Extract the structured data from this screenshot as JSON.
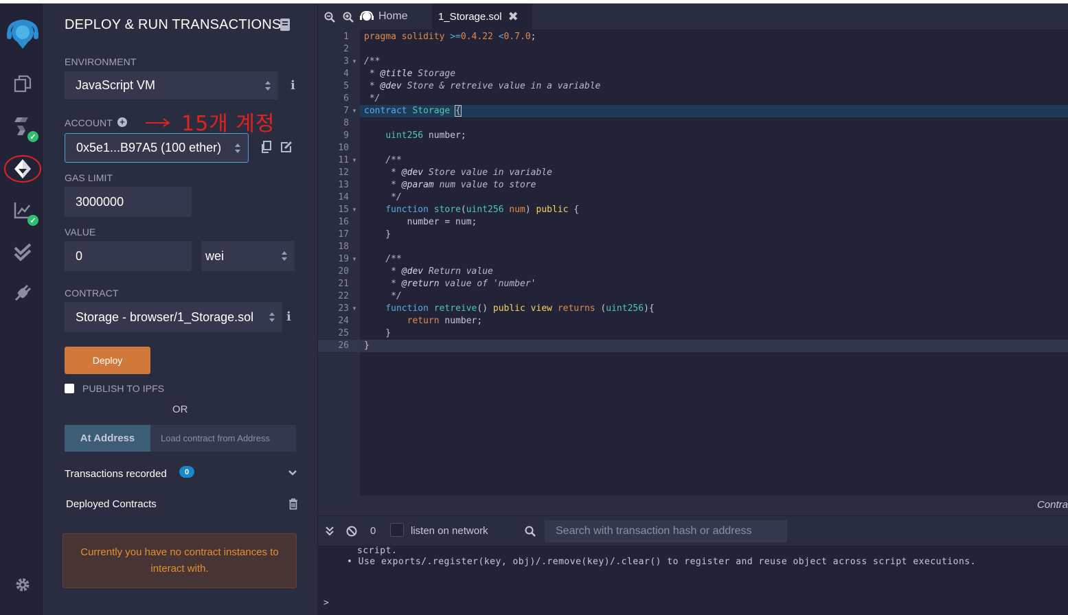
{
  "panel": {
    "title": "DEPLOY & RUN TRANSACTIONS",
    "environment_label": "ENVIRONMENT",
    "environment_value": "JavaScript VM",
    "account_label": "ACCOUNT",
    "account_value": "0x5e1...B97A5 (100 ether)",
    "annotation": "15개 계정",
    "gas_limit_label": "GAS LIMIT",
    "gas_limit_value": "3000000",
    "value_label": "VALUE",
    "value_amount": "0",
    "value_unit": "wei",
    "contract_label": "CONTRACT",
    "contract_value": "Storage - browser/1_Storage.sol",
    "deploy_label": "Deploy",
    "publish_label": "PUBLISH TO IPFS",
    "or_label": "OR",
    "at_address_label": "At Address",
    "load_placeholder": "Load contract from Address",
    "transactions_label": "Transactions recorded",
    "transactions_count": "0",
    "deployed_label": "Deployed Contracts",
    "no_instances_msg": "Currently you have no contract instances to interact with."
  },
  "tabs": {
    "home_label": "Home",
    "file_label": "1_Storage.sol"
  },
  "editor": {
    "line_numbers": [
      "1",
      "2",
      "3",
      "4",
      "5",
      "6",
      "7",
      "8",
      "9",
      "10",
      "11",
      "12",
      "13",
      "14",
      "15",
      "16",
      "17",
      "18",
      "19",
      "20",
      "21",
      "22",
      "23",
      "24",
      "25",
      "26"
    ],
    "fold_lines": [
      3,
      7,
      11,
      15,
      19,
      23
    ]
  },
  "terminal": {
    "right_label": "Contra",
    "pending_count": "0",
    "listen_label": "listen on network",
    "search_placeholder": "Search with transaction hash or address",
    "log_line_1": "script.",
    "log_line_2": "• Use exports/.register(key, obj)/.remove(key)/.clear() to register and reuse object across script executions.",
    "prompt": ">"
  },
  "colors": {
    "deploy_button": "#d0793a",
    "at_address_button": "#3d5c76",
    "annotation_red": "#e0231f",
    "active_line": "#1e3a56",
    "badge_blue": "#1a87c9"
  }
}
